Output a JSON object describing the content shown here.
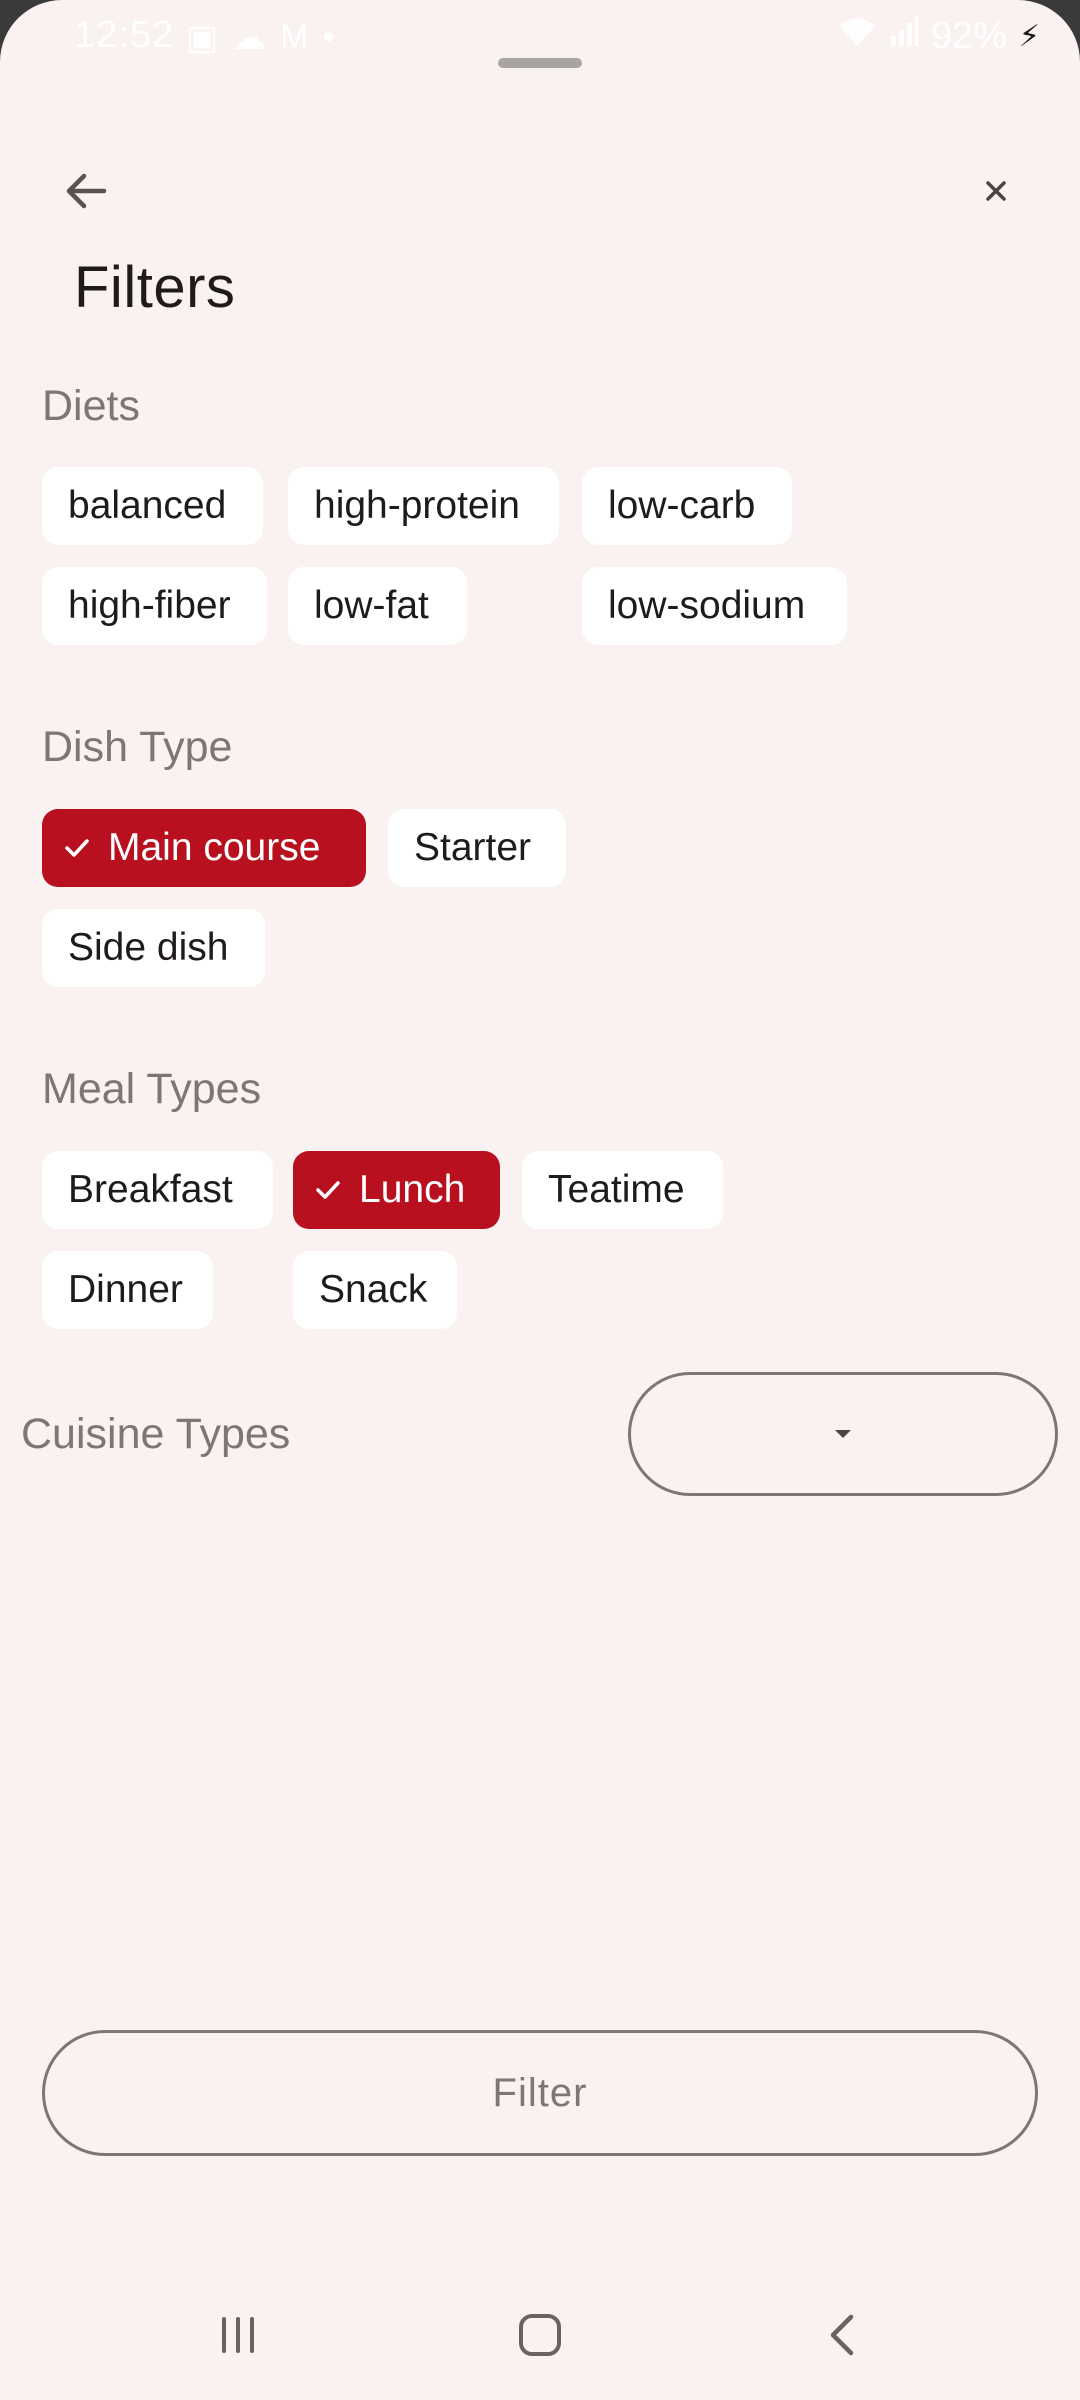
{
  "status_bar": {
    "time": "12:52",
    "battery": "92%"
  },
  "header": {
    "title": "Filters",
    "back_icon": "arrow-left-icon",
    "close_icon": "close-icon"
  },
  "diets": {
    "label": "Diets",
    "chips": [
      "balanced",
      "high-protein",
      "low-carb",
      "high-fiber",
      "low-fat",
      "low-sodium"
    ]
  },
  "dish_type": {
    "label": "Dish Type",
    "chips": [
      "Main course",
      "Starter",
      "Side dish"
    ],
    "selected": [
      "Main course"
    ]
  },
  "meal_types": {
    "label": "Meal Types",
    "chips": [
      "Breakfast",
      "Lunch",
      "Teatime",
      "Dinner",
      "Snack"
    ],
    "selected": [
      "Lunch"
    ]
  },
  "cuisine_types": {
    "label": "Cuisine Types",
    "selected_value": ""
  },
  "actions": {
    "filter_label": "Filter"
  },
  "colors": {
    "accent": "#b8101e",
    "background": "#faf1f1",
    "chip": "#ffffff",
    "muted_text": "#7f7575"
  }
}
